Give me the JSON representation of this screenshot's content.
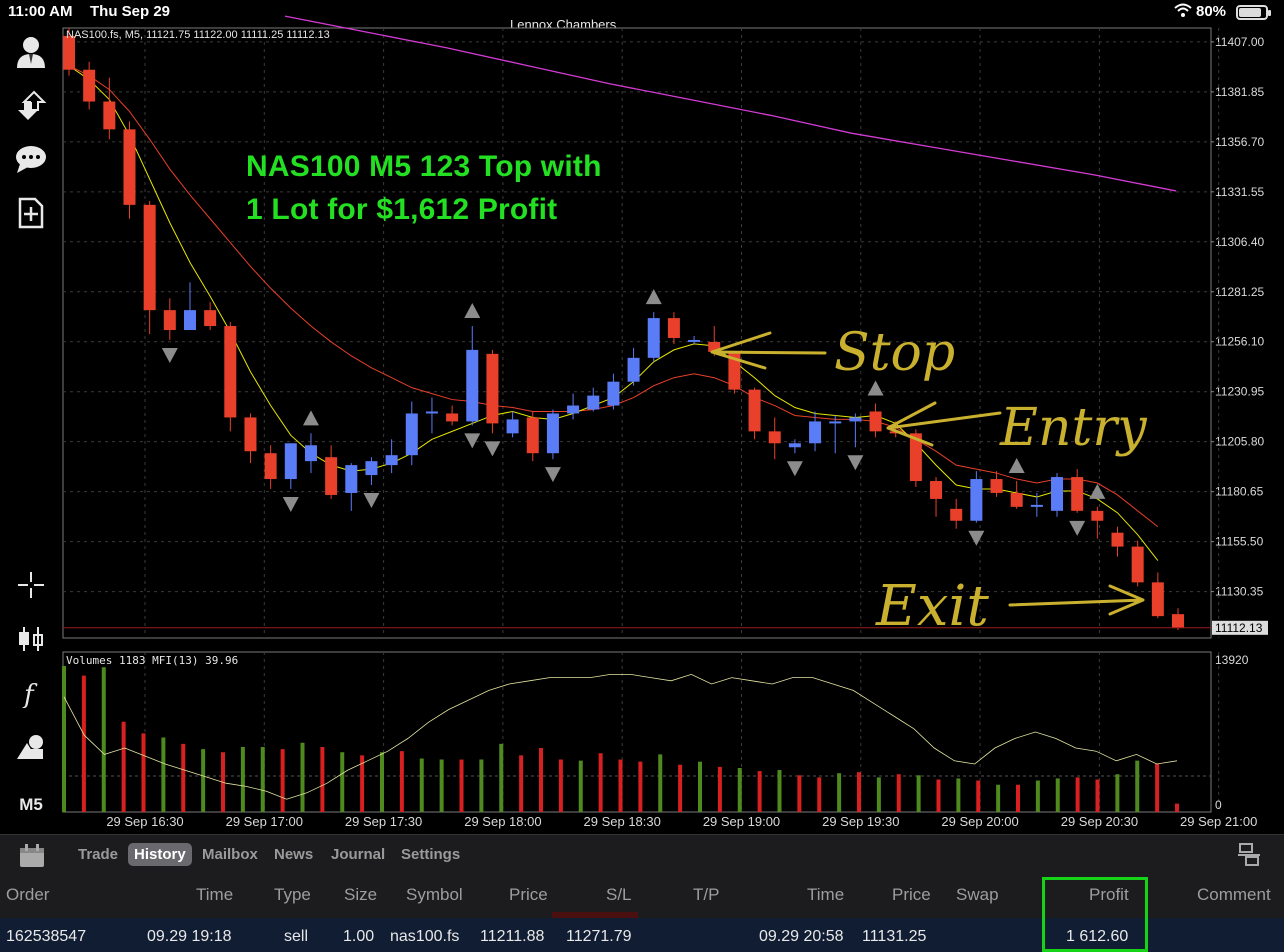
{
  "status_bar": {
    "time": "11:00 AM",
    "date": "Thu Sep 29",
    "account_name": "Lennox Chambers",
    "battery": "80%"
  },
  "chart_header": {
    "ohlc_line": "NAS100.fs, M5, 11121.75 11122.00 11111.25 11112.13",
    "volume_line": "Volumes 1183 MFI(13) 39.96"
  },
  "headline": {
    "line1": "NAS100 M5 123 Top with",
    "line2": "1 Lot for $1,612 Profit"
  },
  "annotations": {
    "stop": "Stop",
    "entry": "Entry",
    "exit": "Exit"
  },
  "price_axis": [
    "11407.00",
    "11381.85",
    "11356.70",
    "11331.55",
    "11306.40",
    "11281.25",
    "11256.10",
    "11230.95",
    "11205.80",
    "11180.65",
    "11155.50",
    "11130.35"
  ],
  "current_price": "11112.13",
  "volume_axis": {
    "top": "13920",
    "bottom": "0"
  },
  "time_axis": [
    "29 Sep 16:30",
    "29 Sep 17:00",
    "29 Sep 17:30",
    "29 Sep 18:00",
    "29 Sep 18:30",
    "29 Sep 19:00",
    "29 Sep 19:30",
    "29 Sep 20:00",
    "29 Sep 20:30",
    "29 Sep 21:00"
  ],
  "toolbar_icons": [
    "account-icon",
    "trade-icon",
    "chat-icon",
    "new-order-icon",
    "crosshair-icon",
    "chart-type-icon",
    "indicators-icon",
    "objects-icon",
    "timeframe-button"
  ],
  "timeframe": "M5",
  "tabs": [
    {
      "label": "Trade",
      "active": false
    },
    {
      "label": "History",
      "active": true
    },
    {
      "label": "Mailbox",
      "active": false
    },
    {
      "label": "News",
      "active": false
    },
    {
      "label": "Journal",
      "active": false
    },
    {
      "label": "Settings",
      "active": false
    }
  ],
  "history_columns": [
    "Order",
    "Time",
    "Type",
    "Size",
    "Symbol",
    "Price",
    "S/L",
    "T/P",
    "Time",
    "Price",
    "Swap",
    "Profit",
    "Comment"
  ],
  "history_row": {
    "order": "162538547",
    "open_time": "09.29 19:18",
    "type": "sell",
    "size": "1.00",
    "symbol": "nas100.fs",
    "open_price": "11211.88",
    "sl": "11271.79",
    "tp": "",
    "close_time": "09.29 20:58",
    "close_price": "11131.25",
    "swap": "",
    "profit": "1 612.60",
    "comment": ""
  },
  "colors": {
    "bull": "#5b7cf7",
    "bear": "#e8402a",
    "ma_fast": "#e6e600",
    "ma_slow": "#e8402a",
    "ma_long": "#d43bd4",
    "headline": "#23e023",
    "annotation": "#c9b02e",
    "vol_up": "#4f8a1f",
    "vol_down": "#d82020",
    "highlight": "#17d317"
  },
  "chart_data": {
    "type": "candlestick",
    "price_axis_range": [
      11107,
      11414
    ],
    "candles": [
      {
        "o": 11410,
        "h": 11414,
        "l": 11390,
        "c": 11393
      },
      {
        "o": 11393,
        "h": 11397,
        "l": 11373,
        "c": 11377
      },
      {
        "o": 11377,
        "h": 11389,
        "l": 11358,
        "c": 11363
      },
      {
        "o": 11363,
        "h": 11367,
        "l": 11318,
        "c": 11325
      },
      {
        "o": 11325,
        "h": 11327,
        "l": 11260,
        "c": 11272
      },
      {
        "o": 11272,
        "h": 11278,
        "l": 11257,
        "c": 11262
      },
      {
        "o": 11262,
        "h": 11286,
        "l": 11262,
        "c": 11272
      },
      {
        "o": 11272,
        "h": 11276,
        "l": 11262,
        "c": 11264
      },
      {
        "o": 11264,
        "h": 11266,
        "l": 11211,
        "c": 11218
      },
      {
        "o": 11218,
        "h": 11220,
        "l": 11195,
        "c": 11201
      },
      {
        "o": 11200,
        "h": 11204,
        "l": 11182,
        "c": 11187
      },
      {
        "o": 11187,
        "h": 11205,
        "l": 11182,
        "c": 11205
      },
      {
        "o": 11196,
        "h": 11210,
        "l": 11190,
        "c": 11204
      },
      {
        "o": 11198,
        "h": 11204,
        "l": 11177,
        "c": 11179
      },
      {
        "o": 11180,
        "h": 11195,
        "l": 11171,
        "c": 11194
      },
      {
        "o": 11189,
        "h": 11198,
        "l": 11184,
        "c": 11196
      },
      {
        "o": 11194,
        "h": 11207,
        "l": 11190,
        "c": 11199
      },
      {
        "o": 11199,
        "h": 11226,
        "l": 11194,
        "c": 11220
      },
      {
        "o": 11220,
        "h": 11228,
        "l": 11210,
        "c": 11221
      },
      {
        "o": 11220,
        "h": 11224,
        "l": 11214,
        "c": 11216
      },
      {
        "o": 11216,
        "h": 11264,
        "l": 11214,
        "c": 11252
      },
      {
        "o": 11250,
        "h": 11252,
        "l": 11210,
        "c": 11215
      },
      {
        "o": 11210,
        "h": 11221,
        "l": 11208,
        "c": 11217
      },
      {
        "o": 11218,
        "h": 11221,
        "l": 11196,
        "c": 11200
      },
      {
        "o": 11200,
        "h": 11222,
        "l": 11197,
        "c": 11220
      },
      {
        "o": 11220,
        "h": 11230,
        "l": 11217,
        "c": 11224
      },
      {
        "o": 11222,
        "h": 11233,
        "l": 11221,
        "c": 11229
      },
      {
        "o": 11224,
        "h": 11240,
        "l": 11222,
        "c": 11236
      },
      {
        "o": 11236,
        "h": 11253,
        "l": 11234,
        "c": 11248
      },
      {
        "o": 11248,
        "h": 11271,
        "l": 11246,
        "c": 11268
      },
      {
        "o": 11268,
        "h": 11271,
        "l": 11255,
        "c": 11258
      },
      {
        "o": 11256,
        "h": 11259,
        "l": 11255,
        "c": 11257
      },
      {
        "o": 11256,
        "h": 11264,
        "l": 11249,
        "c": 11251
      },
      {
        "o": 11251,
        "h": 11251,
        "l": 11230,
        "c": 11232
      },
      {
        "o": 11232,
        "h": 11233,
        "l": 11207,
        "c": 11211
      },
      {
        "o": 11211,
        "h": 11218,
        "l": 11197,
        "c": 11205
      },
      {
        "o": 11203,
        "h": 11207,
        "l": 11200,
        "c": 11205
      },
      {
        "o": 11205,
        "h": 11221,
        "l": 11201,
        "c": 11216
      },
      {
        "o": 11215,
        "h": 11219,
        "l": 11200,
        "c": 11216
      },
      {
        "o": 11216,
        "h": 11220,
        "l": 11203,
        "c": 11218
      },
      {
        "o": 11221,
        "h": 11225,
        "l": 11208,
        "c": 11211
      },
      {
        "o": 11211,
        "h": 11216,
        "l": 11208,
        "c": 11210
      },
      {
        "o": 11210,
        "h": 11212,
        "l": 11183,
        "c": 11186
      },
      {
        "o": 11186,
        "h": 11188,
        "l": 11168,
        "c": 11177
      },
      {
        "o": 11172,
        "h": 11177,
        "l": 11162,
        "c": 11166
      },
      {
        "o": 11166,
        "h": 11191,
        "l": 11165,
        "c": 11187
      },
      {
        "o": 11187,
        "h": 11191,
        "l": 11178,
        "c": 11180
      },
      {
        "o": 11180,
        "h": 11186,
        "l": 11172,
        "c": 11173
      },
      {
        "o": 11173,
        "h": 11180,
        "l": 11168,
        "c": 11174
      },
      {
        "o": 11171,
        "h": 11190,
        "l": 11168,
        "c": 11188
      },
      {
        "o": 11188,
        "h": 11192,
        "l": 11170,
        "c": 11171
      },
      {
        "o": 11171,
        "h": 11173,
        "l": 11157,
        "c": 11166
      },
      {
        "o": 11160,
        "h": 11163,
        "l": 11148,
        "c": 11153
      },
      {
        "o": 11153,
        "h": 11156,
        "l": 11133,
        "c": 11135
      },
      {
        "o": 11135,
        "h": 11140,
        "l": 11117,
        "c": 11118
      },
      {
        "o": 11119,
        "h": 11122,
        "l": 11111,
        "c": 11112
      }
    ],
    "volumes": [
      {
        "v": 13920,
        "up": true
      },
      {
        "v": 13000,
        "up": false
      },
      {
        "v": 13800,
        "up": true
      },
      {
        "v": 8600,
        "up": false
      },
      {
        "v": 7500,
        "up": false
      },
      {
        "v": 7100,
        "up": true
      },
      {
        "v": 6500,
        "up": false
      },
      {
        "v": 6000,
        "up": true
      },
      {
        "v": 5700,
        "up": false
      },
      {
        "v": 6200,
        "up": true
      },
      {
        "v": 6200,
        "up": true
      },
      {
        "v": 6000,
        "up": false
      },
      {
        "v": 6600,
        "up": true
      },
      {
        "v": 6200,
        "up": false
      },
      {
        "v": 5700,
        "up": true
      },
      {
        "v": 5400,
        "up": false
      },
      {
        "v": 5700,
        "up": true
      },
      {
        "v": 5800,
        "up": false
      },
      {
        "v": 5100,
        "up": true
      },
      {
        "v": 5000,
        "up": true
      },
      {
        "v": 5000,
        "up": false
      },
      {
        "v": 5000,
        "up": true
      },
      {
        "v": 6500,
        "up": true
      },
      {
        "v": 5400,
        "up": false
      },
      {
        "v": 6100,
        "up": false
      },
      {
        "v": 5000,
        "up": false
      },
      {
        "v": 4900,
        "up": true
      },
      {
        "v": 5600,
        "up": false
      },
      {
        "v": 5000,
        "up": false
      },
      {
        "v": 4800,
        "up": false
      },
      {
        "v": 5500,
        "up": true
      },
      {
        "v": 4500,
        "up": false
      },
      {
        "v": 4800,
        "up": true
      },
      {
        "v": 4300,
        "up": false
      },
      {
        "v": 4200,
        "up": true
      },
      {
        "v": 3900,
        "up": false
      },
      {
        "v": 4000,
        "up": true
      },
      {
        "v": 3500,
        "up": false
      },
      {
        "v": 3300,
        "up": false
      },
      {
        "v": 3700,
        "up": true
      },
      {
        "v": 3800,
        "up": false
      },
      {
        "v": 3300,
        "up": true
      },
      {
        "v": 3600,
        "up": false
      },
      {
        "v": 3500,
        "up": true
      },
      {
        "v": 3100,
        "up": false
      },
      {
        "v": 3200,
        "up": true
      },
      {
        "v": 3000,
        "up": false
      },
      {
        "v": 2600,
        "up": true
      },
      {
        "v": 2600,
        "up": false
      },
      {
        "v": 3000,
        "up": true
      },
      {
        "v": 3200,
        "up": true
      },
      {
        "v": 3300,
        "up": false
      },
      {
        "v": 3100,
        "up": false
      },
      {
        "v": 3600,
        "up": true
      },
      {
        "v": 4900,
        "up": true
      },
      {
        "v": 4600,
        "up": false
      },
      {
        "v": 800,
        "up": false
      }
    ],
    "fractals_up": [
      12,
      20,
      29,
      40,
      47,
      51
    ],
    "fractals_down": [
      5,
      11,
      15,
      20,
      21,
      24,
      36,
      39,
      45,
      50
    ],
    "series": [
      {
        "name": "MA slow",
        "values": [
          11395,
          11390,
          11383,
          11372,
          11358,
          11343,
          11330,
          11318,
          11306,
          11294,
          11283,
          11273,
          11264,
          11256,
          11249,
          11243,
          11238,
          11233,
          11230,
          11227,
          11226,
          11224,
          11223,
          11221,
          11221,
          11221,
          11222,
          11224,
          11228,
          11234,
          11238,
          11240,
          11238,
          11234,
          11228,
          11224,
          11219,
          11218,
          11217,
          11217,
          11216,
          11213,
          11207,
          11201,
          11194,
          11192,
          11190,
          11187,
          11185,
          11187,
          11187,
          11185,
          11179,
          11171,
          11163
        ]
      },
      {
        "name": "MA fast",
        "values": [
          11395,
          11388,
          11378,
          11360,
          11338,
          11316,
          11296,
          11279,
          11261,
          11241,
          11224,
          11209,
          11200,
          11194,
          11191,
          11192,
          11195,
          11200,
          11207,
          11211,
          11215,
          11219,
          11221,
          11218,
          11217,
          11220,
          11224,
          11228,
          11236,
          11246,
          11252,
          11255,
          11254,
          11246,
          11238,
          11229,
          11223,
          11220,
          11219,
          11218,
          11219,
          11215,
          11205,
          11194,
          11184,
          11182,
          11182,
          11180,
          11178,
          11181,
          11181,
          11177,
          11170,
          11159,
          11146
        ]
      },
      {
        "name": "MA long",
        "values": [
          11420,
          11412,
          11404,
          11395,
          11386,
          11378,
          11370,
          11361,
          11354,
          11347,
          11340,
          11332
        ]
      }
    ],
    "mfi_values": [
      72,
      48,
      36,
      40,
      35,
      30,
      26,
      22,
      18,
      16,
      13,
      8,
      12,
      18,
      26,
      32,
      38,
      46,
      56,
      64,
      70,
      76,
      80,
      82,
      84,
      84,
      84,
      86,
      86,
      84,
      82,
      86,
      80,
      84,
      82,
      80,
      84,
      84,
      80,
      76,
      68,
      60,
      52,
      40,
      32,
      30,
      40,
      46,
      50,
      46,
      40,
      38,
      32,
      36,
      30,
      32
    ]
  }
}
